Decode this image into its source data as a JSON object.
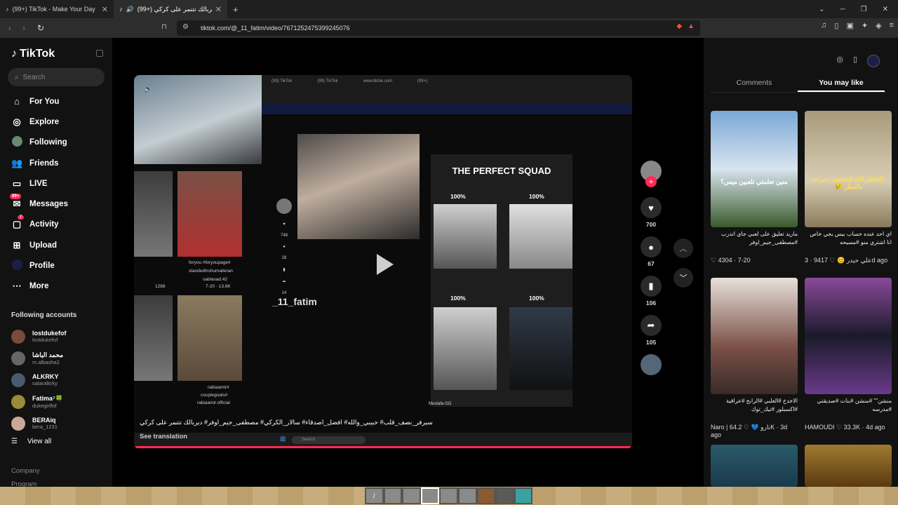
{
  "browser": {
    "tabs": [
      {
        "title": "(99+) TikTok - Make Your Day",
        "active": false
      },
      {
        "title": "(99+) ديربالك تتنمر على كركي",
        "active": true
      }
    ],
    "new_tab": "+",
    "url": "tiktok.com/@_11_fatim/video/7671252475399245076"
  },
  "sidebar": {
    "logo": "TikTok",
    "search_placeholder": "Search",
    "nav": [
      {
        "label": "For You",
        "icon": "home-icon"
      },
      {
        "label": "Explore",
        "icon": "compass-icon"
      },
      {
        "label": "Following",
        "icon": "following-avatar-icon"
      },
      {
        "label": "Friends",
        "icon": "friends-icon"
      },
      {
        "label": "LIVE",
        "icon": "live-icon"
      },
      {
        "label": "Messages",
        "icon": "messages-icon",
        "badge": "99+"
      },
      {
        "label": "Activity",
        "icon": "activity-icon",
        "badge": "7"
      },
      {
        "label": "Upload",
        "icon": "upload-icon"
      },
      {
        "label": "Profile",
        "icon": "profile-avatar-icon"
      },
      {
        "label": "More",
        "icon": "more-icon"
      }
    ],
    "following_title": "Following accounts",
    "following": [
      {
        "name": "lostdukefof",
        "handle": "lostdukefof"
      },
      {
        "name": "محمد الباشا",
        "handle": "m.albasha2"
      },
      {
        "name": "ALKRKY",
        "handle": "salaralkrky"
      },
      {
        "name": "Fatima⁷🍀",
        "handle": "dukegirlfof"
      },
      {
        "name": "BERAiq",
        "handle": "bera_1231"
      }
    ],
    "view_all": "View all",
    "company": "Company",
    "program": "Program"
  },
  "video": {
    "inner_username": "_11_fatim",
    "inner_counts": [
      "748",
      "28",
      "14"
    ],
    "squad_title": "THE PERFECT SQUAD",
    "squad_pcts": [
      "100%",
      "100%",
      "100%",
      "100%"
    ],
    "inner_status": "Mustafa GO",
    "grid_captions": [
      "foryou #foryoupage#",
      "standwithshumaileran",
      "sablasad.42",
      "7-20 · 13.6K",
      "1288",
      "rabiaamir#",
      "couplegoals#",
      "rabiaamir.official"
    ],
    "caption": "سيرفر_نصف_قلب# حبيبي_والله# افضل_اصدقاء# سالار_الكركي# مصطفى_جيم_اوفر# ديربالك تتنمر على كركي",
    "see_translation": "See translation",
    "taskbar_search": "Search"
  },
  "actions": {
    "likes": "700",
    "comments": "67",
    "saves": "106",
    "shares": "105"
  },
  "right_panel": {
    "tabs": [
      "Comments",
      "You may like"
    ],
    "active_tab": "You may like",
    "cards": [
      {
        "desc": "ماريد تعليق على لعبي جاي اتدرب #مصطفى_جيم_اوفر",
        "likes": "4304",
        "date": "7-20",
        "author": ""
      },
      {
        "desc": "اي احد عنده حساب بيس يجي خاص انا اشتري منو #مسيحه",
        "likes": "9417",
        "date": "3d ago",
        "author": "علي حيدر 😊"
      },
      {
        "desc": "الاخدخ #الغلبي #الرابح #عراقية #اكسبلور #تيك_توك",
        "likes": "64.2K",
        "date": "3d ago",
        "author": "Naro | نارو 💙"
      },
      {
        "desc": "منشن\"\" #منشن #بنات #صديقتي #مدرسه",
        "likes": "33.3K",
        "date": "4d ago",
        "author": "HAMOUDI"
      }
    ],
    "card_texts": [
      "منين تعلمتي تلعبين ميس؟",
      "الخاطر الله لاتمشون سرعه بالمطر 😢"
    ]
  }
}
